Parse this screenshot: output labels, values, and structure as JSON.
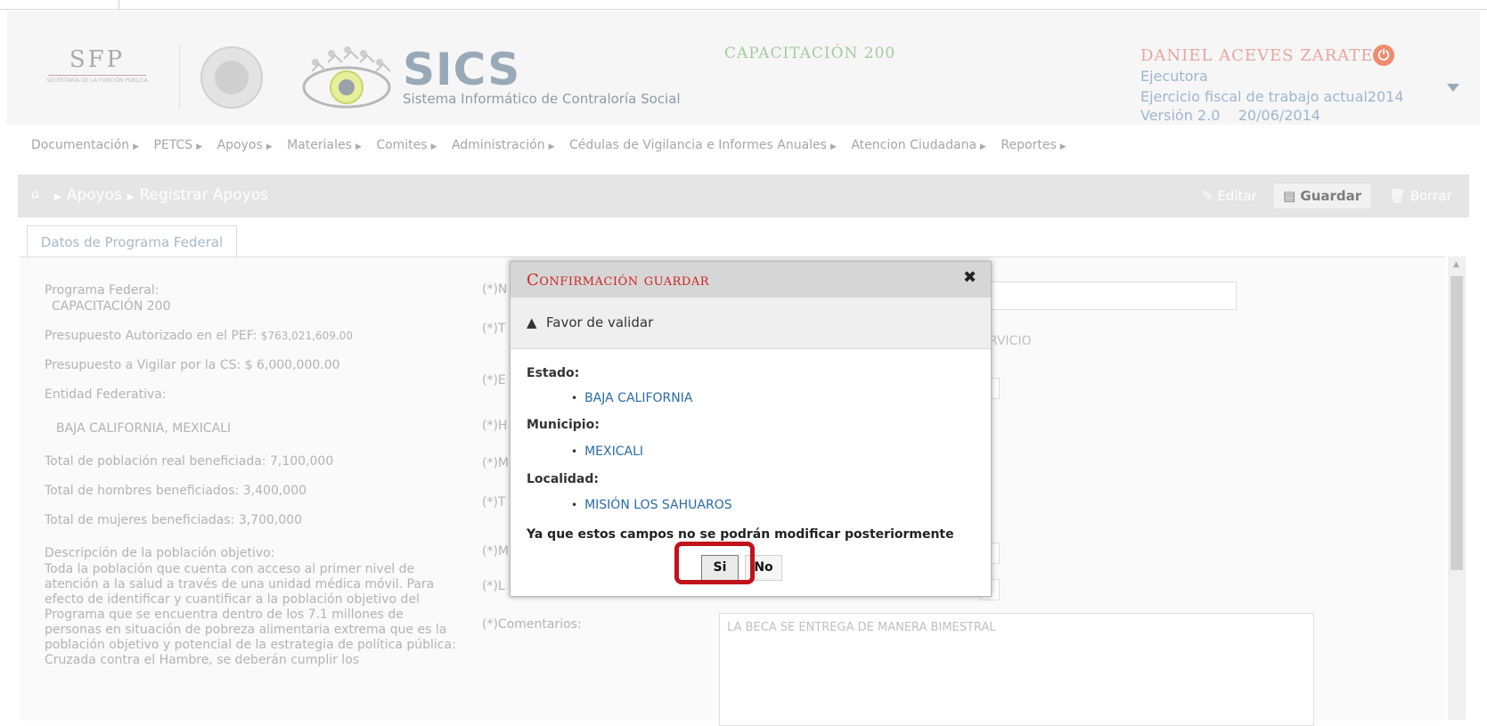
{
  "header": {
    "sfp_logo": "SFP",
    "sfp_caption": "SECRETARÍA DE LA FUNCIÓN PÚBLICA",
    "app_title": "SICS",
    "app_subtitle": "Sistema Informático de Contraloría Social",
    "program_title": "CAPACITACIÓN 200",
    "user_name": "DANIEL ACEVES ZARATE",
    "user_role": "Ejecutora",
    "user_period": "Ejercicio fiscal de trabajo actual2014",
    "user_version": "Versión 2.0    20/06/2014"
  },
  "nav": {
    "items": [
      {
        "label": "Documentación"
      },
      {
        "label": "PETCS"
      },
      {
        "label": "Apoyos"
      },
      {
        "label": "Materiales"
      },
      {
        "label": "Comites"
      },
      {
        "label": "Administración"
      },
      {
        "label": "Cédulas de Vigilancia e Informes Anuales"
      },
      {
        "label": "Atencion Ciudadana"
      },
      {
        "label": "Reportes"
      }
    ]
  },
  "toolbar": {
    "breadcrumb_1": "Apoyos",
    "breadcrumb_2": "Registrar Apoyos",
    "edit_label": "Editar",
    "save_label": "Guardar",
    "delete_label": "Borrar"
  },
  "tab": {
    "label": "Datos de Programa Federal"
  },
  "left": {
    "programa_label": "Programa Federal:",
    "programa_value": "CAPACITACIÓN 200",
    "presupuesto_pef_label": "Presupuesto Autorizado en el PEF:",
    "presupuesto_pef_value": "$763,021,609.00",
    "presupuesto_cs_label": "Presupuesto a Vigilar por la CS:",
    "presupuesto_cs_value": "$ 6,000,000.00",
    "entidad_label": "Entidad Federativa:",
    "entidad_value": "BAJA CALIFORNIA, MEXICALI",
    "poblacion_label": "Total de población real beneficiada:",
    "poblacion_value": "7,100,000",
    "hombres_label": "Total de hombres beneficiados:",
    "hombres_value": "3,400,000",
    "mujeres_label": "Total de mujeres beneficiadas:",
    "mujeres_value": "3,700,000",
    "descripcion_label": "Descripción de la población objetivo:",
    "descripcion_text": "Toda la población que cuenta con acceso al primer nivel de atención a la salud a través de una unidad médica móvil. Para efecto de identificar y cuantificar a la población objetivo del Programa que se encuentra dentro de los 7.1 millones de personas en situación de pobreza alimentaria extrema que es la población objetivo y potencial de la estrategia de política pública: Cruzada contra el Hambre, se deberán cumplir los"
  },
  "form": {
    "labels": [
      "(*)N",
      "(*)T",
      "(*)E",
      "(*)H",
      "(*)M",
      "(*)T",
      "(*)M",
      "(*)L"
    ],
    "tipo_partial": "RVICIO",
    "comentarios_label": "(*)Comentarios:",
    "comentarios_value": "LA BECA SE ENTREGA DE MANERA BIMESTRAL"
  },
  "dialog": {
    "title": "Confirmación guardar",
    "warning": "Favor de validar",
    "estado_label": "Estado:",
    "estado_value": "BAJA CALIFORNIA",
    "municipio_label": "Municipio:",
    "municipio_value": "MEXICALI",
    "localidad_label": "Localidad:",
    "localidad_value": "MISIÓN LOS SAHUAROS",
    "note": "Ya que estos campos no se podrán modificar posteriormente",
    "yes_label": "Si",
    "no_label": "No"
  },
  "colors": {
    "dialog_title": "#cf2424",
    "link_values": "#2a6ba8",
    "highlight": "#c0121a"
  }
}
